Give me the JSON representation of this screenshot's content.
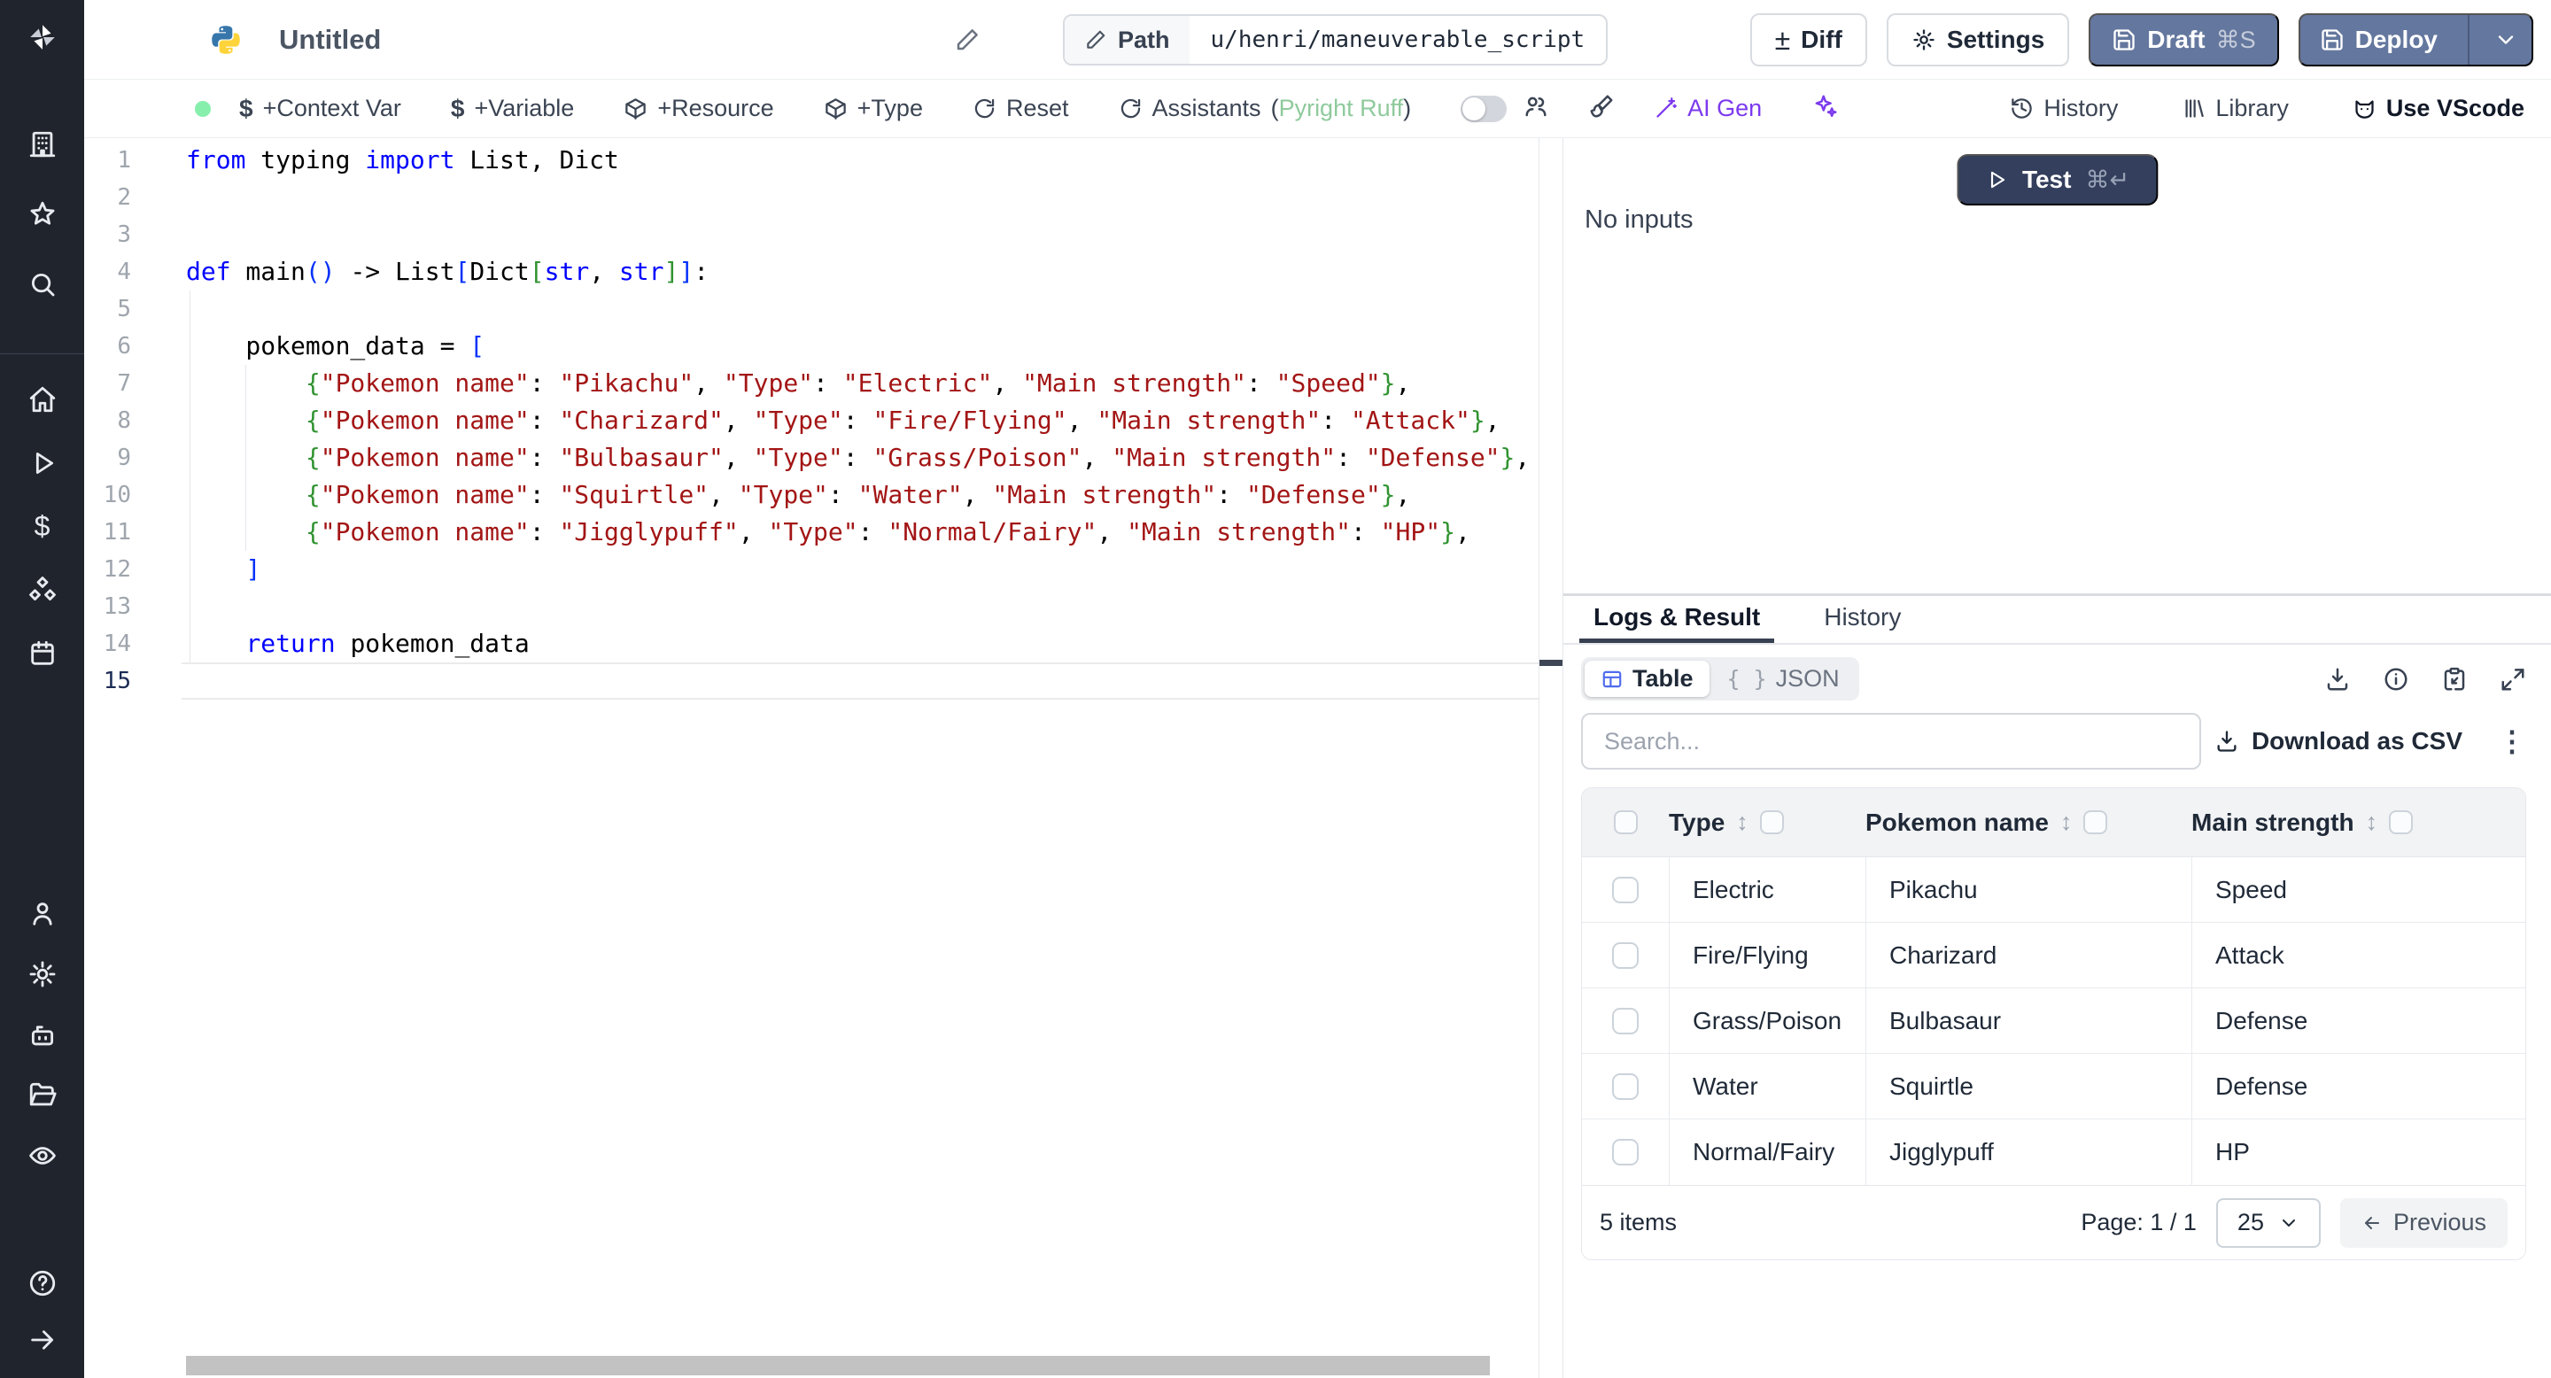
{
  "app": {
    "name": "Windmill script editor"
  },
  "colors": {
    "slate_button": "#64779e",
    "test_button": "#333f5c",
    "ai_purple": "#7c3aed",
    "assistants_green": "#8fca9c",
    "status_green": "#86efac",
    "keyword_blue": "#0000ff",
    "string_red": "#a31515",
    "bracket_blue": "#0431fa",
    "bracket_green": "#319331"
  },
  "topbar": {
    "title": "Untitled",
    "path_label": "Path",
    "path_value": "u/henri/maneuverable_script",
    "diff_label": "Diff",
    "diff_glyph": "±",
    "settings_label": "Settings",
    "draft_label": "Draft",
    "draft_shortcut": "⌘S",
    "deploy_label": "Deploy"
  },
  "toolbar": {
    "context_var_label": "+Context Var",
    "variable_label": "+Variable",
    "resource_label": "+Resource",
    "type_label": "+Type",
    "reset_label": "Reset",
    "assistants_label": "Assistants",
    "assistants_paren_open": "(",
    "assistants_lang": "Pyright Ruff",
    "assistants_paren_close": ")",
    "ai_gen_label": "AI Gen",
    "history_label": "History",
    "library_label": "Library",
    "vscode_label": "Use VScode",
    "dollar_glyph": "$"
  },
  "sidebar": {
    "icons": [
      "windmill-logo",
      "workspace",
      "favorites",
      "search",
      "home",
      "runs",
      "variables",
      "resources",
      "schedules",
      "users",
      "settings",
      "workers",
      "folders",
      "audit-logs",
      "help",
      "expand"
    ]
  },
  "editor": {
    "active_line": 15,
    "lines": [
      {
        "n": 1,
        "tokens": [
          [
            "k",
            "from"
          ],
          [
            "t",
            " typing "
          ],
          [
            "k",
            "import"
          ],
          [
            "t",
            " List, Dict"
          ]
        ]
      },
      {
        "n": 2,
        "tokens": []
      },
      {
        "n": 3,
        "tokens": []
      },
      {
        "n": 4,
        "tokens": [
          [
            "k",
            "def"
          ],
          [
            "t",
            " main"
          ],
          [
            "b1",
            "()"
          ],
          [
            "t",
            " -> List"
          ],
          [
            "b1",
            "["
          ],
          [
            "t",
            "Dict"
          ],
          [
            "b2",
            "["
          ],
          [
            "k",
            "str"
          ],
          [
            "t",
            ", "
          ],
          [
            "k",
            "str"
          ],
          [
            "b2",
            "]"
          ],
          [
            "b1",
            "]"
          ],
          [
            "t",
            ":"
          ]
        ]
      },
      {
        "n": 5,
        "tokens": []
      },
      {
        "n": 6,
        "tokens": [
          [
            "t",
            "    pokemon_data = "
          ],
          [
            "b1",
            "["
          ]
        ]
      },
      {
        "n": 7,
        "tokens": [
          [
            "t",
            "        "
          ],
          [
            "b2",
            "{"
          ],
          [
            "s",
            "\"Pokemon name\""
          ],
          [
            "t",
            ": "
          ],
          [
            "s",
            "\"Pikachu\""
          ],
          [
            "t",
            ", "
          ],
          [
            "s",
            "\"Type\""
          ],
          [
            "t",
            ": "
          ],
          [
            "s",
            "\"Electric\""
          ],
          [
            "t",
            ", "
          ],
          [
            "s",
            "\"Main strength\""
          ],
          [
            "t",
            ": "
          ],
          [
            "s",
            "\"Speed\""
          ],
          [
            "b2",
            "}"
          ],
          [
            "t",
            ","
          ]
        ]
      },
      {
        "n": 8,
        "tokens": [
          [
            "t",
            "        "
          ],
          [
            "b2",
            "{"
          ],
          [
            "s",
            "\"Pokemon name\""
          ],
          [
            "t",
            ": "
          ],
          [
            "s",
            "\"Charizard\""
          ],
          [
            "t",
            ", "
          ],
          [
            "s",
            "\"Type\""
          ],
          [
            "t",
            ": "
          ],
          [
            "s",
            "\"Fire/Flying\""
          ],
          [
            "t",
            ", "
          ],
          [
            "s",
            "\"Main strength\""
          ],
          [
            "t",
            ": "
          ],
          [
            "s",
            "\"Attack\""
          ],
          [
            "b2",
            "}"
          ],
          [
            "t",
            ","
          ]
        ]
      },
      {
        "n": 9,
        "tokens": [
          [
            "t",
            "        "
          ],
          [
            "b2",
            "{"
          ],
          [
            "s",
            "\"Pokemon name\""
          ],
          [
            "t",
            ": "
          ],
          [
            "s",
            "\"Bulbasaur\""
          ],
          [
            "t",
            ", "
          ],
          [
            "s",
            "\"Type\""
          ],
          [
            "t",
            ": "
          ],
          [
            "s",
            "\"Grass/Poison\""
          ],
          [
            "t",
            ", "
          ],
          [
            "s",
            "\"Main strength\""
          ],
          [
            "t",
            ": "
          ],
          [
            "s",
            "\"Defense\""
          ],
          [
            "b2",
            "}"
          ],
          [
            "t",
            ","
          ]
        ]
      },
      {
        "n": 10,
        "tokens": [
          [
            "t",
            "        "
          ],
          [
            "b2",
            "{"
          ],
          [
            "s",
            "\"Pokemon name\""
          ],
          [
            "t",
            ": "
          ],
          [
            "s",
            "\"Squirtle\""
          ],
          [
            "t",
            ", "
          ],
          [
            "s",
            "\"Type\""
          ],
          [
            "t",
            ": "
          ],
          [
            "s",
            "\"Water\""
          ],
          [
            "t",
            ", "
          ],
          [
            "s",
            "\"Main strength\""
          ],
          [
            "t",
            ": "
          ],
          [
            "s",
            "\"Defense\""
          ],
          [
            "b2",
            "}"
          ],
          [
            "t",
            ","
          ]
        ]
      },
      {
        "n": 11,
        "tokens": [
          [
            "t",
            "        "
          ],
          [
            "b2",
            "{"
          ],
          [
            "s",
            "\"Pokemon name\""
          ],
          [
            "t",
            ": "
          ],
          [
            "s",
            "\"Jigglypuff\""
          ],
          [
            "t",
            ", "
          ],
          [
            "s",
            "\"Type\""
          ],
          [
            "t",
            ": "
          ],
          [
            "s",
            "\"Normal/Fairy\""
          ],
          [
            "t",
            ", "
          ],
          [
            "s",
            "\"Main strength\""
          ],
          [
            "t",
            ": "
          ],
          [
            "s",
            "\"HP\""
          ],
          [
            "b2",
            "}"
          ],
          [
            "t",
            ","
          ]
        ]
      },
      {
        "n": 12,
        "tokens": [
          [
            "t",
            "    "
          ],
          [
            "b1",
            "]"
          ]
        ]
      },
      {
        "n": 13,
        "tokens": []
      },
      {
        "n": 14,
        "tokens": [
          [
            "t",
            "    "
          ],
          [
            "k",
            "return"
          ],
          [
            "t",
            " pokemon_data"
          ]
        ]
      },
      {
        "n": 15,
        "tokens": []
      }
    ]
  },
  "run_panel": {
    "test_label": "Test",
    "test_shortcut": "⌘↵",
    "no_inputs_label": "No inputs",
    "tabs": {
      "logs_result": "Logs & Result",
      "history": "History"
    },
    "view_toggle": {
      "table_label": "Table",
      "json_label": "JSON",
      "braces_glyph": "{ }"
    },
    "search_placeholder": "Search...",
    "download_csv_label": "Download as CSV",
    "kebab_glyph": "⋮",
    "sort_glyph": "↕",
    "table": {
      "columns": [
        "Type",
        "Pokemon name",
        "Main strength"
      ],
      "rows": [
        [
          "Electric",
          "Pikachu",
          "Speed"
        ],
        [
          "Fire/Flying",
          "Charizard",
          "Attack"
        ],
        [
          "Grass/Poison",
          "Bulbasaur",
          "Defense"
        ],
        [
          "Water",
          "Squirtle",
          "Defense"
        ],
        [
          "Normal/Fairy",
          "Jigglypuff",
          "HP"
        ]
      ],
      "items_label": "5 items",
      "page_label": "Page: 1 / 1",
      "page_size": "25",
      "previous_label": "Previous",
      "previous_glyph": "←"
    }
  }
}
